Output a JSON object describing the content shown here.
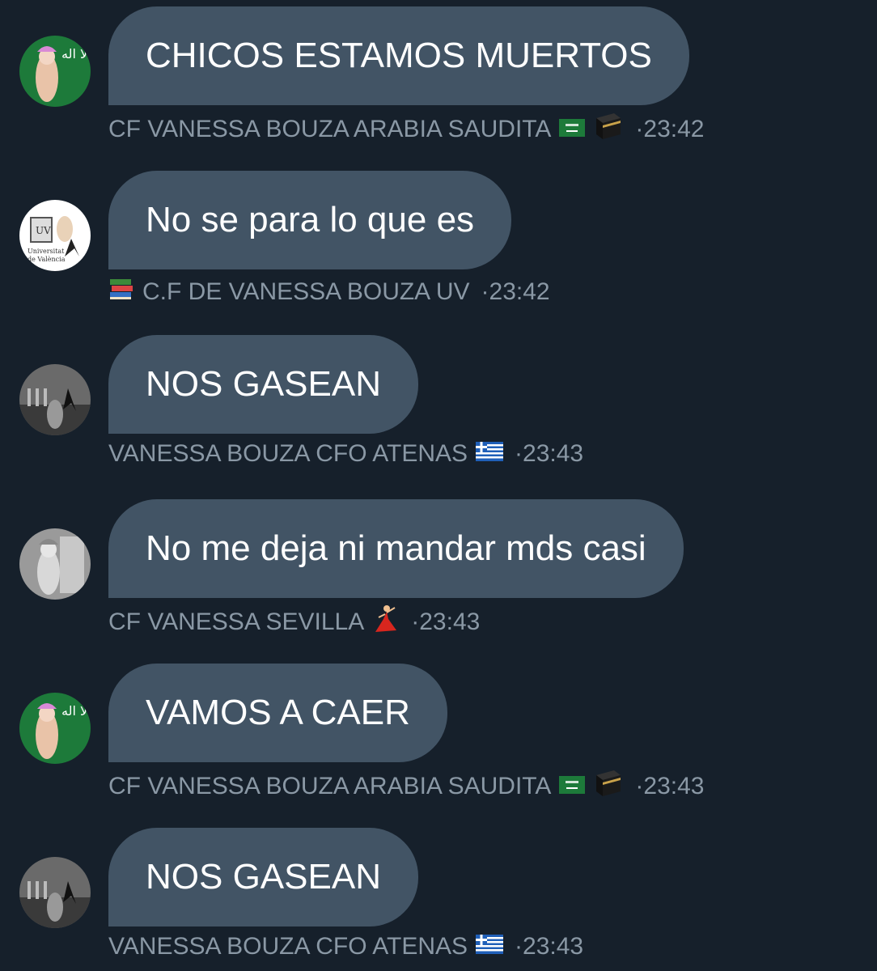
{
  "colors": {
    "background": "#16202b",
    "bubble": "#425465",
    "bubble_text": "#ffffff",
    "meta_text": "#8a98a5"
  },
  "messages": [
    {
      "text": "CHICOS ESTAMOS MUERTOS",
      "sender": "CF VANESSA BOUZA ARABIA SAUDITA",
      "emojis": [
        "saudi-flag-icon",
        "kaaba-icon"
      ],
      "time": "·23:42",
      "avatar": "avatar-saudi"
    },
    {
      "text": "No se para lo que es",
      "sender": "C.F DE VANESSA BOUZA UV",
      "emojis_before": [
        "books-icon"
      ],
      "time": "·23:42",
      "avatar": "avatar-university"
    },
    {
      "text": "NOS GASEAN",
      "sender": "VANESSA BOUZA CFO ATENAS",
      "emojis": [
        "greece-flag-icon"
      ],
      "time": "·23:43",
      "avatar": "avatar-atenas"
    },
    {
      "text": "No me deja ni mandar mds casi",
      "sender": "CF VANESSA SEVILLA",
      "emojis": [
        "dancer-icon"
      ],
      "time": "·23:43",
      "avatar": "avatar-sevilla"
    },
    {
      "text": "VAMOS A CAER",
      "sender": "CF VANESSA BOUZA ARABIA SAUDITA",
      "emojis": [
        "saudi-flag-icon",
        "kaaba-icon"
      ],
      "time": "·23:43",
      "avatar": "avatar-saudi"
    },
    {
      "text": "NOS GASEAN",
      "sender": "VANESSA BOUZA CFO ATENAS",
      "emojis": [
        "greece-flag-icon"
      ],
      "time": "·23:43",
      "avatar": "avatar-atenas"
    }
  ]
}
